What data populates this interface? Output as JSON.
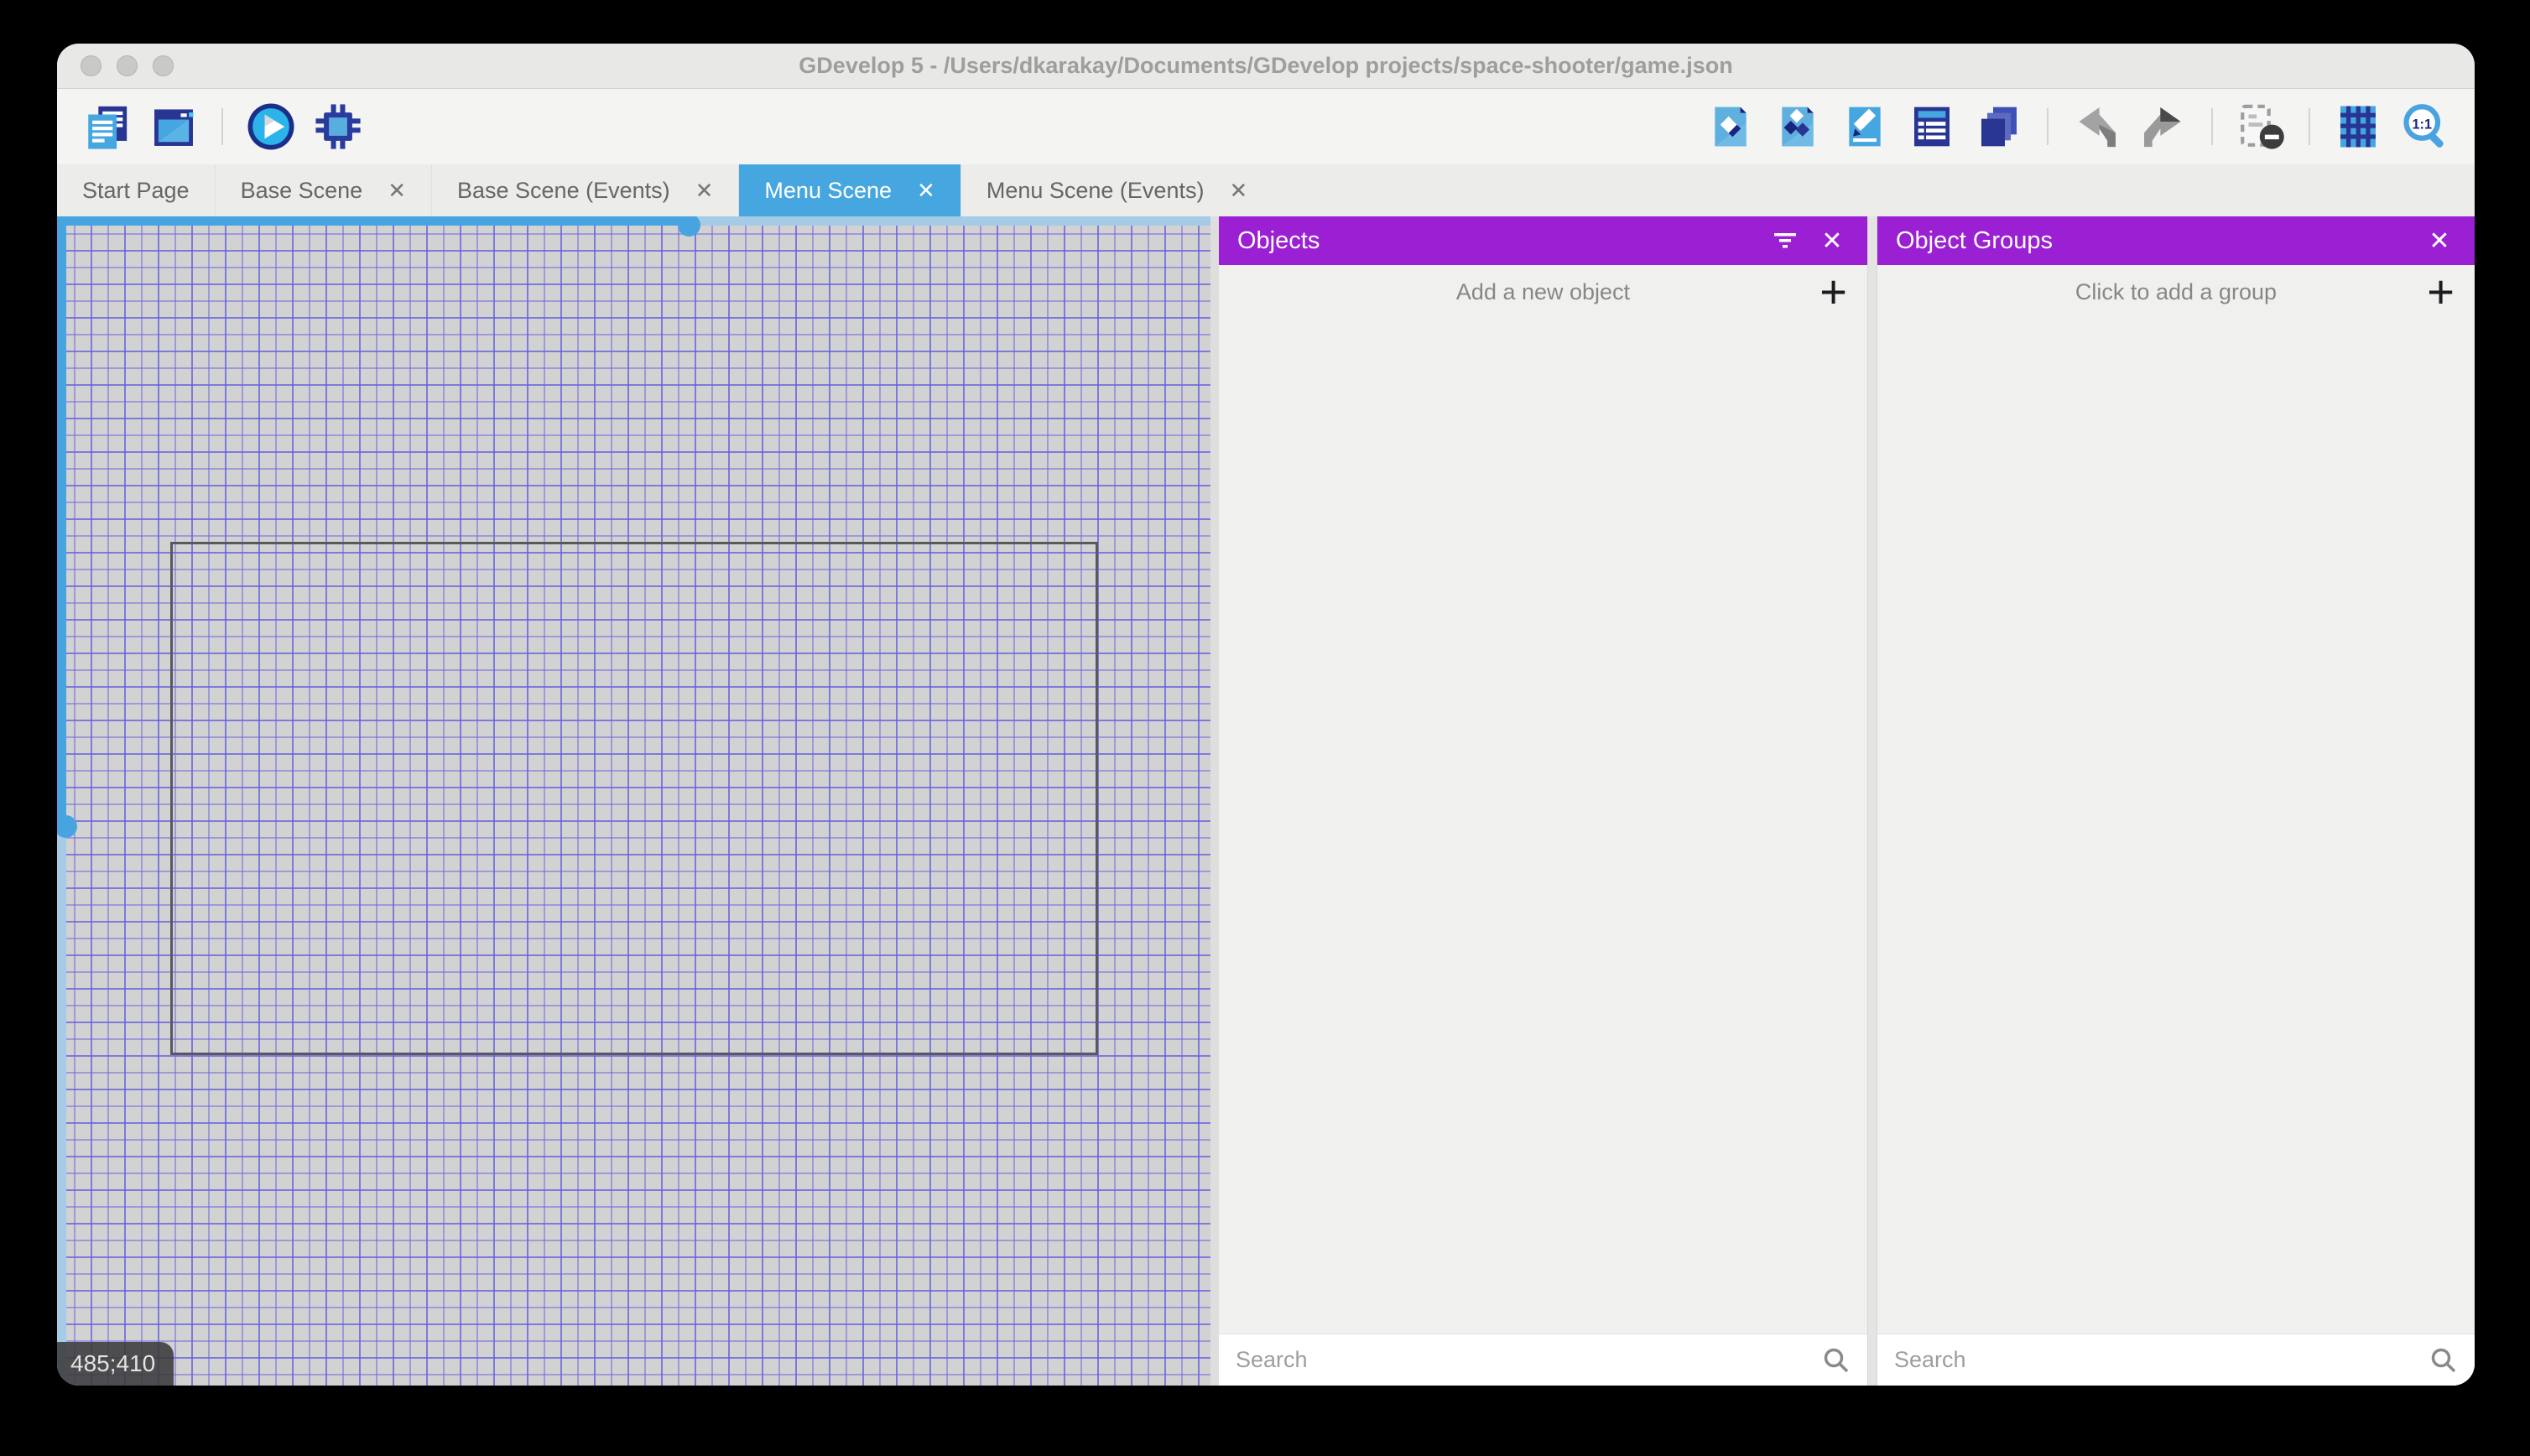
{
  "window": {
    "title": "GDevelop 5 - /Users/dkarakay/Documents/GDevelop projects/space-shooter/game.json"
  },
  "toolbar": {
    "left_icons": [
      "project-manager-icon",
      "window-icon",
      "play-preview-icon",
      "debug-icon"
    ],
    "right_icons": [
      "objects-panel-icon",
      "object-groups-panel-icon",
      "properties-panel-icon",
      "instances-list-panel-icon",
      "layers-panel-icon",
      "undo-icon",
      "redo-icon",
      "window-mask-icon",
      "grid-icon",
      "zoom-1-1-icon"
    ]
  },
  "tabs": [
    {
      "label": "Start Page",
      "closable": false,
      "active": false
    },
    {
      "label": "Base Scene",
      "closable": true,
      "active": false
    },
    {
      "label": "Base Scene (Events)",
      "closable": true,
      "active": false
    },
    {
      "label": "Menu Scene",
      "closable": true,
      "active": true
    },
    {
      "label": "Menu Scene (Events)",
      "closable": true,
      "active": false
    }
  ],
  "canvas": {
    "cursor_coordinates": "485;410"
  },
  "objects_panel": {
    "title": "Objects",
    "add_label": "Add a new object",
    "search_placeholder": "Search"
  },
  "object_groups_panel": {
    "title": "Object Groups",
    "add_label": "Click to add a group",
    "search_placeholder": "Search"
  },
  "glyphs": {
    "close": "✕",
    "plus": "+"
  },
  "colors": {
    "accent_blue": "#46a7e0",
    "panel_purple": "#9b1fd3",
    "grid_line": "#6862e2",
    "canvas_bg": "#d2d2d2",
    "icon_navy": "#283593",
    "icon_blue": "#4aa8e0"
  }
}
